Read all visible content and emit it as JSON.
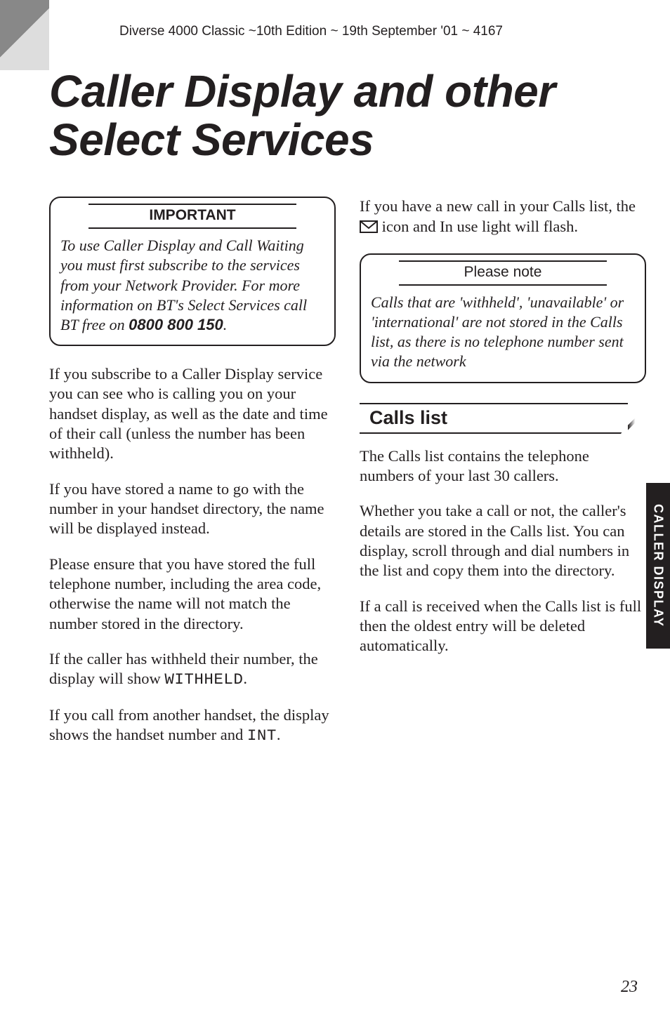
{
  "header_line": "Diverse 4000 Classic ~10th Edition ~ 19th September '01 ~ 4167",
  "title_line1": "Caller Display and other",
  "title_line2": "Select Services",
  "side_tab": "CALLER DISPLAY",
  "page_number": "23",
  "box_important": {
    "label": "IMPORTANT",
    "body_pre": "To use Caller Display and Call Waiting you must first subscribe to the services from your Network Provider. For more information on BT's Select Services call BT free on ",
    "phone": "0800 800 150",
    "body_post": "."
  },
  "left": {
    "p1": "If you subscribe to a Caller Display service you can see who is calling you on your handset display, as well as the date and time of their call (unless the number has been withheld).",
    "p2": "If you have stored a name to go with the number in your handset directory, the name will be displayed instead.",
    "p3": "Please ensure that you have stored the full telephone number, including the area code, otherwise the name will not match the number stored in the directory.",
    "p4_pre": "If the caller has withheld their number, the display will show ",
    "p4_mono": "WITHHELD",
    "p4_post": ".",
    "p5_pre": "If you call from another handset, the display shows the handset number and ",
    "p5_mono": "INT",
    "p5_post": "."
  },
  "right": {
    "p1_pre": "If you have a new call in your Calls list, the ",
    "p1_post": " icon and In use light will flash.",
    "note_label": "Please note",
    "note_body": "Calls that are 'withheld', 'unavailable' or 'international' are not stored in the Calls list, as there is no telephone number sent via the network",
    "section": "Calls list",
    "p2": "The Calls list contains the telephone numbers of your last 30 callers.",
    "p3": "Whether you take a call or not, the caller's details are stored in the Calls list. You can display, scroll through and dial numbers in the list and copy them into the directory.",
    "p4": "If a call is received when the Calls list is full then the oldest entry will be deleted automatically."
  }
}
